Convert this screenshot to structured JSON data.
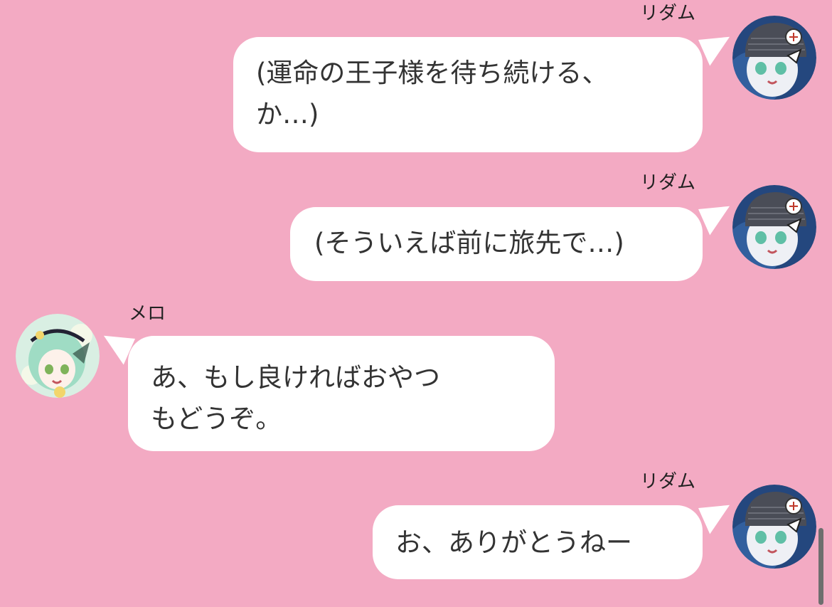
{
  "messages": [
    {
      "sender": "リダム",
      "side": "right",
      "avatar_icon": "rhythm-avatar-icon",
      "lines": [
        "(運命の王子様を待ち続ける、",
        "か…)"
      ]
    },
    {
      "sender": "リダム",
      "side": "right",
      "avatar_icon": "rhythm-avatar-icon",
      "lines": [
        "(そういえば前に旅先で…)"
      ]
    },
    {
      "sender": "メロ",
      "side": "left",
      "avatar_icon": "melo-avatar-icon",
      "lines": [
        "あ、もし良ければおやつ",
        "もどうぞ。"
      ]
    },
    {
      "sender": "リダム",
      "side": "right",
      "avatar_icon": "rhythm-avatar-icon",
      "lines": [
        "お、ありがとうねー"
      ]
    }
  ],
  "colors": {
    "background": "#f3aac3",
    "bubble": "#ffffff",
    "text": "#333333"
  }
}
